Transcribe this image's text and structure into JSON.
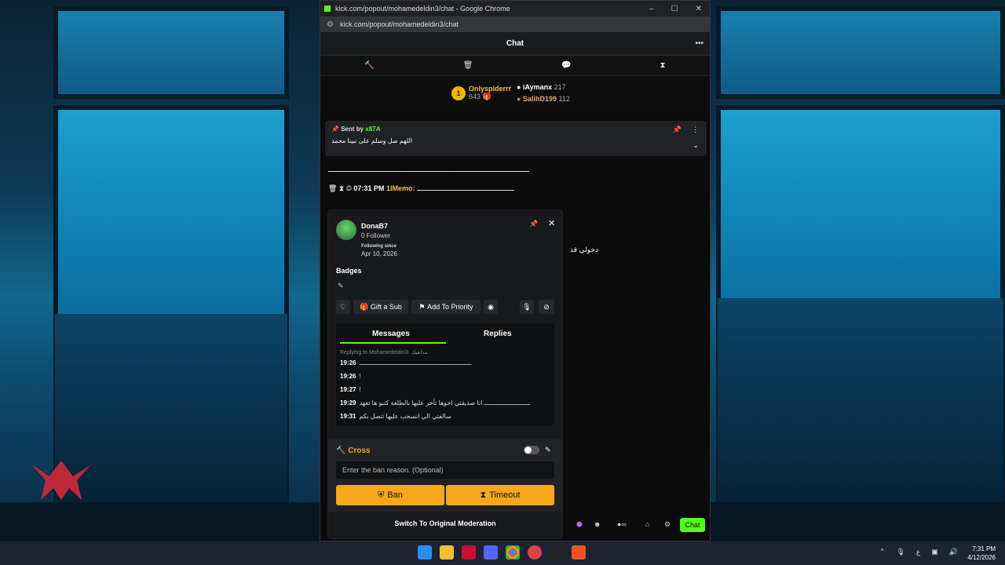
{
  "window": {
    "title": "kick.com/popout/mohamedeldin3/chat - Google Chrome",
    "url": "kick.com/popout/mohamedeldin3/chat",
    "controls": [
      "–",
      "☐",
      "✕"
    ]
  },
  "chat": {
    "header_title": "Chat",
    "mod_tools": [
      "hammer",
      "trash",
      "chat-bubble",
      "hourglass"
    ],
    "leaderboard": {
      "first": {
        "rank": "1",
        "name": "Onlyspiderrr",
        "count": "643"
      },
      "second": {
        "name": "iAymanx",
        "count": "217"
      },
      "third": {
        "name": "SalihD199",
        "count": "112"
      }
    },
    "pinned": {
      "sent_by": "Sent by",
      "user": "x87A",
      "message": "اللهم صل وسلم على نبينا محمد"
    },
    "lines": [
      {
        "text": "ـــــــــــــــــــــــــــــــــــــــــــــــــــــــــــــــــــــــــــــــــــــــــــــــــ"
      },
      {
        "time": "07:31 PM",
        "user": "1lMemo:",
        "text": "ـــــــــــــــــــــــــــــــــــــــــــــــ"
      },
      {
        "time": "07:31 PM",
        "user": "",
        "text": ""
      }
    ],
    "side_text": "دخولي قد",
    "send_button": "Chat"
  },
  "user_card": {
    "username": "DonaB7",
    "followers": "0 Follower",
    "following_since_label": "Following since",
    "following_since": "Apr 10, 2026",
    "badges_title": "Badges",
    "actions": {
      "gift": "Gift a Sub",
      "priority": "Add To Priority"
    },
    "tabs": {
      "messages": "Messages",
      "replies": "Replies"
    },
    "reply_context": "Replying to Mohamedeldin3: مذاهبك",
    "messages": [
      {
        "time": "19:26",
        "text": "ـــــــــــــــــــــــــــــــــــــــــــــــــــــــــــــ"
      },
      {
        "time": "19:26",
        "text": "!"
      },
      {
        "time": "19:27",
        "text": "!"
      },
      {
        "time": "19:29",
        "text": "ـــــــــــــــــــــــــ انا صديقتي اخوها تأخر عليها بالطلعة كتبو ها تعهد"
      },
      {
        "time": "19:31",
        "text": "سالفتي الي انسحب عليها تتصل بكم"
      }
    ],
    "moderation": {
      "rule_label": "Cross",
      "reason_placeholder": "Enter the ban reason. (Optional)",
      "ban": "Ban",
      "timeout": "Timeout"
    },
    "switch_label": "Switch To Original Moderation"
  },
  "taskbar": {
    "time": "7:31 PM",
    "date": "4/12/2026",
    "tray_lang": "ع"
  }
}
